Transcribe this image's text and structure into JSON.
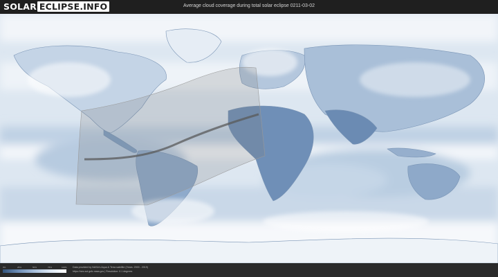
{
  "header": {
    "logo_part1": "SOLAR",
    "logo_part2": "ECLIPSE.INFO",
    "title": "Average cloud coverage during total solar eclipse 0211-03-02"
  },
  "legend": {
    "ticks": [
      "0%",
      "25%",
      "50%",
      "75%",
      "100%"
    ],
    "colors": [
      "#34557d",
      "#6f8fb7",
      "#a9c0dc",
      "#dde7f2",
      "#ffffff"
    ]
  },
  "footer": {
    "credit_line1": "Data provided by NASA's Aqua & Terra satellite (Years: 2000 - 2019)",
    "credit_line2": "https://neo.sci.gsfc.nasa.gov | Resolution: 0.1 degrees"
  },
  "colors": {
    "ocean_cloud": "#dfe8f2",
    "clear_sky": "#6f8fb7",
    "eclipse_shadow": "#5a5a5a"
  }
}
